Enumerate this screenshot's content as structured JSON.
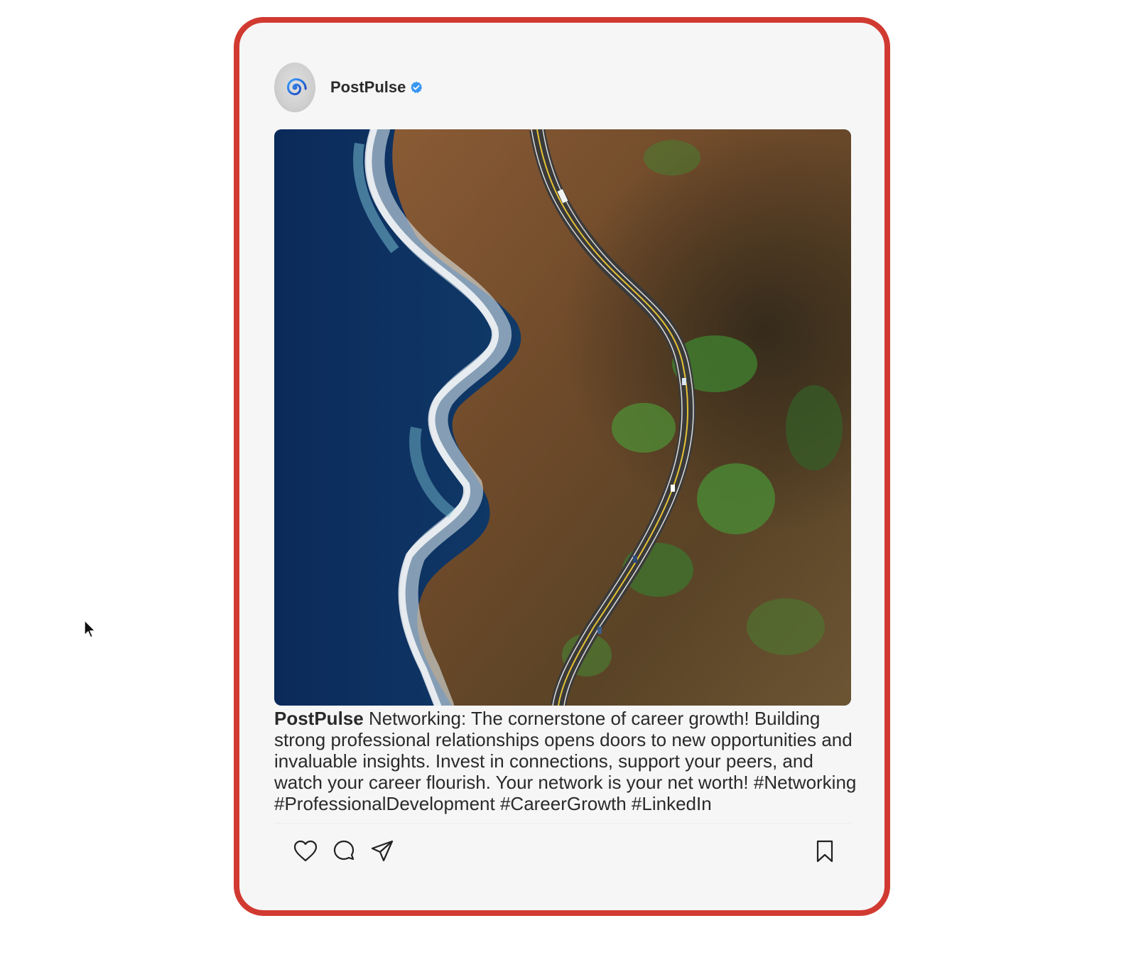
{
  "post": {
    "username": "PostPulse",
    "avatar_icon": "spiral-logo-icon",
    "verified_icon": "verified-badge-icon",
    "image_description_icon": "coastal-road-aerial-photo",
    "caption_username": "PostPulse",
    "caption_text": " Networking: The cornerstone of career growth! Building strong professional relationships opens doors to new opportunities and invaluable insights. Invest in connections, support your peers, and watch your career flourish. Your network is your net worth! #Networking #ProfessionalDevelopment #CareerGrowth #LinkedIn"
  },
  "actions": {
    "like_icon": "heart-icon",
    "comment_icon": "comment-icon",
    "share_icon": "send-icon",
    "save_icon": "bookmark-icon"
  },
  "colors": {
    "frame_border": "#d13a31",
    "card_background": "#f6f6f6",
    "verified_blue": "#3897f0"
  }
}
